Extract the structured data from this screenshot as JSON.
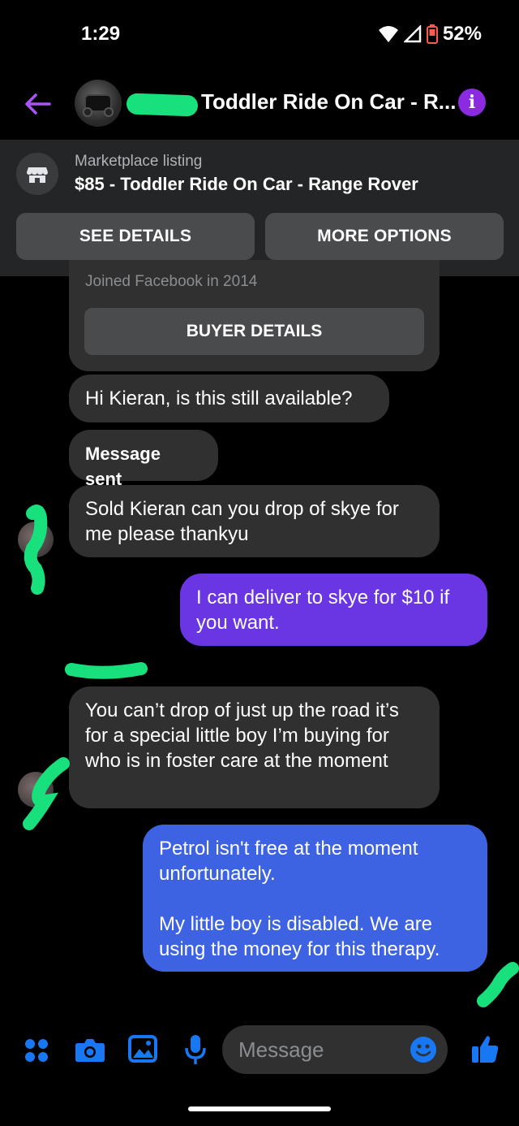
{
  "status_bar": {
    "time": "1:29",
    "battery": "52%"
  },
  "header": {
    "title": "Toddler Ride On Car - R..."
  },
  "marketplace": {
    "label": "Marketplace listing",
    "listing": "$85 - Toddler Ride On Car - Range Rover",
    "see_details": "SEE DETAILS",
    "more_options": "MORE OPTIONS"
  },
  "buyer_card": {
    "joined": "Joined Facebook in 2014",
    "buyer_details": "BUYER DETAILS"
  },
  "messages": [
    {
      "from": "them",
      "text": "Hi Kieran, is this still available?"
    },
    {
      "from": "them",
      "text": "Message sent"
    },
    {
      "from": "them",
      "text": "Sold Kieran can you drop of skye for me please thankyu"
    },
    {
      "from": "me",
      "text": "I can deliver to skye for $10 if you want."
    },
    {
      "from": "them",
      "text": "You can’t drop of just up the road it’s for a special  little boy I’m buying for who is in foster care at the moment"
    },
    {
      "from": "me",
      "text": "Petrol isn't free at the moment unfortunately.\n\nMy little boy is disabled. We are using the money for this therapy."
    }
  ],
  "composer": {
    "placeholder": "Message"
  },
  "colors": {
    "accent": "#8a2be2",
    "sent_purple": "#6a35e3",
    "sent_blue": "#3d63e3",
    "redaction": "#18e07d"
  }
}
